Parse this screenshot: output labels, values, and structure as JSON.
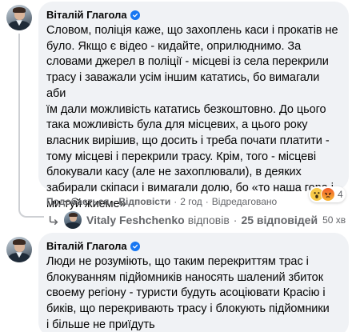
{
  "comment1": {
    "author": "Віталій Глагола",
    "text_lines": [
      "Словом, поліція каже, що захоплень каси і прокатів не",
      "було. Якщо є відео - кидайте, оприлюднимо. За",
      "словами джерел в поліції - місцеві із села перекрили",
      "трасу і заважали усім іншим кататись, бо вимагали аби",
      "їм дали можливість кататись безкоштовно. До цього",
      "така можливість була для місцевих, а цього року",
      "власник вирішив, що досить і треба почати платити -",
      "тому місцеві і перекрили трасу. Крім, того - місцеві",
      "блокували касу (але не захоплювали), в деяких",
      "забирали скіпаси і вимагали долю, бо «то наша гора і",
      "ми туй жиеме»"
    ],
    "actions": {
      "like": "Подобається",
      "reply": "Відповісти",
      "time": "2 год",
      "edited": "Відредаговано"
    },
    "reactions": {
      "icons": [
        "wow-icon",
        "angry-icon"
      ],
      "count": "4"
    }
  },
  "replies": {
    "name": "Vitaly Feshchenko",
    "replied_word": "відповів",
    "separator": "·",
    "count_label": "25 відповідей",
    "time": "50 хв"
  },
  "comment2": {
    "author": "Віталій Глагола",
    "text_lines": [
      "Люди не розуміють, що таким перекриттям трас і",
      "блокуванням підйомників наносять шалений збиток",
      "своему регіону - туристи будуть асоціювати Красію і",
      "биків, що перекривають трасу і блокують підйомники",
      "і більше не приїдуть"
    ]
  },
  "colors": {
    "bubble": "#f0f2f5",
    "secondary_text": "#65676b",
    "verified_badge": "#1877f2"
  }
}
